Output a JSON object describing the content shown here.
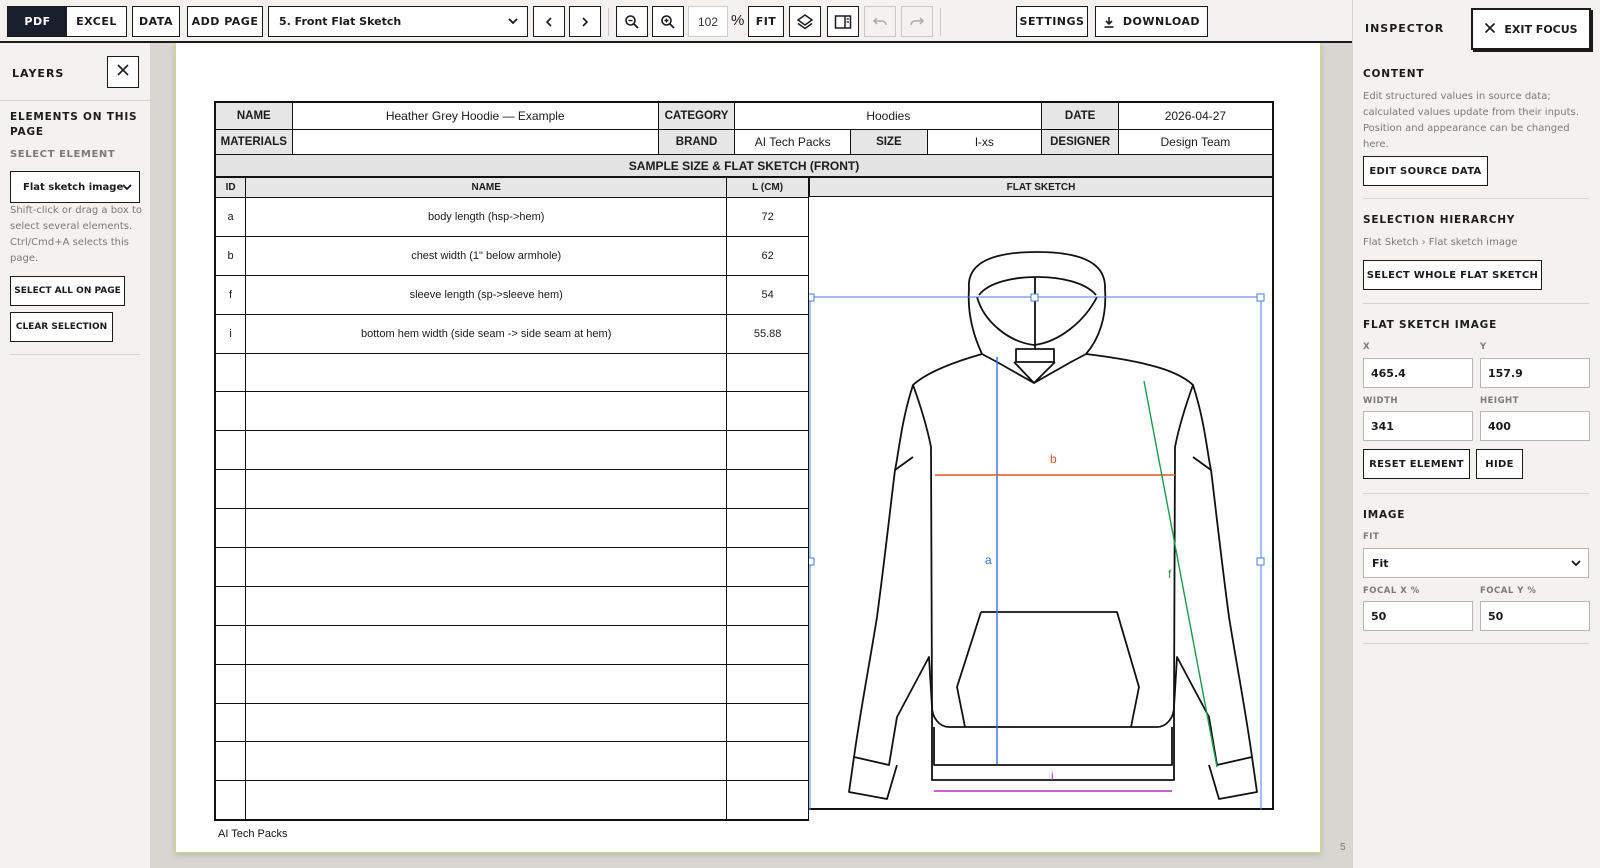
{
  "toolbar": {
    "pdf": "PDF",
    "excel": "EXCEL",
    "data": "DATA",
    "add_page": "ADD PAGE",
    "page_select": "5. Front Flat Sketch",
    "zoom_value": "102",
    "zoom_unit": "%",
    "fit": "FIT",
    "settings": "SETTINGS",
    "download": "DOWNLOAD",
    "icons": [
      "chevron-left-icon",
      "chevron-right-icon",
      "zoom-out-icon",
      "zoom-in-icon",
      "layers-icon",
      "panel-icon",
      "undo-icon",
      "redo-icon",
      "download-icon"
    ]
  },
  "layers": {
    "title": "LAYERS",
    "elements_title": "ELEMENTS ON THIS PAGE",
    "select_label": "SELECT ELEMENT",
    "select_value": "Flat sketch image",
    "hint": "Shift-click or drag a box to select several elements. Ctrl/Cmd+A selects this page.",
    "select_all": "SELECT ALL ON PAGE",
    "clear": "CLEAR SELECTION"
  },
  "document": {
    "header": {
      "name_label": "NAME",
      "name": "Heather Grey Hoodie — Example",
      "category_label": "CATEGORY",
      "category": "Hoodies",
      "date_label": "DATE",
      "date": "2026-04-27",
      "materials_label": "MATERIALS",
      "materials": "",
      "brand_label": "BRAND",
      "brand": "AI Tech Packs",
      "size_label": "SIZE",
      "size": "l-xs",
      "designer_label": "DESIGNER",
      "designer": "Design Team"
    },
    "section_title": "SAMPLE SIZE & FLAT SKETCH (FRONT)",
    "columns": {
      "id": "ID",
      "name": "NAME",
      "length": "L (CM)",
      "sketch": "FLAT SKETCH"
    },
    "rows": [
      {
        "id": "a",
        "name": "body length (hsp->hem)",
        "value": "72"
      },
      {
        "id": "b",
        "name": "chest width (1\" below armhole)",
        "value": "62"
      },
      {
        "id": "f",
        "name": "sleeve length (sp->sleeve hem)",
        "value": "54"
      },
      {
        "id": "i",
        "name": "bottom hem width (side seam -> side seam at hem)",
        "value": "55.88"
      },
      {
        "id": "",
        "name": "",
        "value": ""
      },
      {
        "id": "",
        "name": "",
        "value": ""
      },
      {
        "id": "",
        "name": "",
        "value": ""
      },
      {
        "id": "",
        "name": "",
        "value": ""
      },
      {
        "id": "",
        "name": "",
        "value": ""
      },
      {
        "id": "",
        "name": "",
        "value": ""
      },
      {
        "id": "",
        "name": "",
        "value": ""
      },
      {
        "id": "",
        "name": "",
        "value": ""
      },
      {
        "id": "",
        "name": "",
        "value": ""
      },
      {
        "id": "",
        "name": "",
        "value": ""
      },
      {
        "id": "",
        "name": "",
        "value": ""
      },
      {
        "id": "",
        "name": "",
        "value": ""
      }
    ],
    "sketch_labels": {
      "a": "a",
      "b": "b",
      "f": "f",
      "i": "i"
    },
    "colors": {
      "a": "#2f6fe0",
      "b": "#e0552a",
      "f": "#1f9a4a",
      "i": "#c02cc0",
      "selection": "#4a7ee8"
    },
    "footer": "AI Tech Packs",
    "page_number": "5"
  },
  "inspector": {
    "title": "INSPECTOR",
    "exit_focus": "EXIT FOCUS",
    "content_title": "CONTENT",
    "content_text": "Edit structured values in source data; calculated values update from their inputs. Position and appearance can be changed here.",
    "edit_source": "EDIT SOURCE DATA",
    "hierarchy_title": "SELECTION HIERARCHY",
    "hierarchy_path": "Flat Sketch › Flat sketch image",
    "select_whole": "SELECT WHOLE FLAT SKETCH",
    "image_section_title": "FLAT SKETCH IMAGE",
    "x_label": "X",
    "x": "465.4",
    "y_label": "Y",
    "y": "157.9",
    "width_label": "WIDTH",
    "width": "341",
    "height_label": "HEIGHT",
    "height": "400",
    "reset": "RESET ELEMENT",
    "hide": "HIDE",
    "image_title": "IMAGE",
    "fit_label": "FIT",
    "fit_value": "Fit",
    "focal_x_label": "FOCAL X %",
    "focal_x": "50",
    "focal_y_label": "FOCAL Y %",
    "focal_y": "50"
  }
}
